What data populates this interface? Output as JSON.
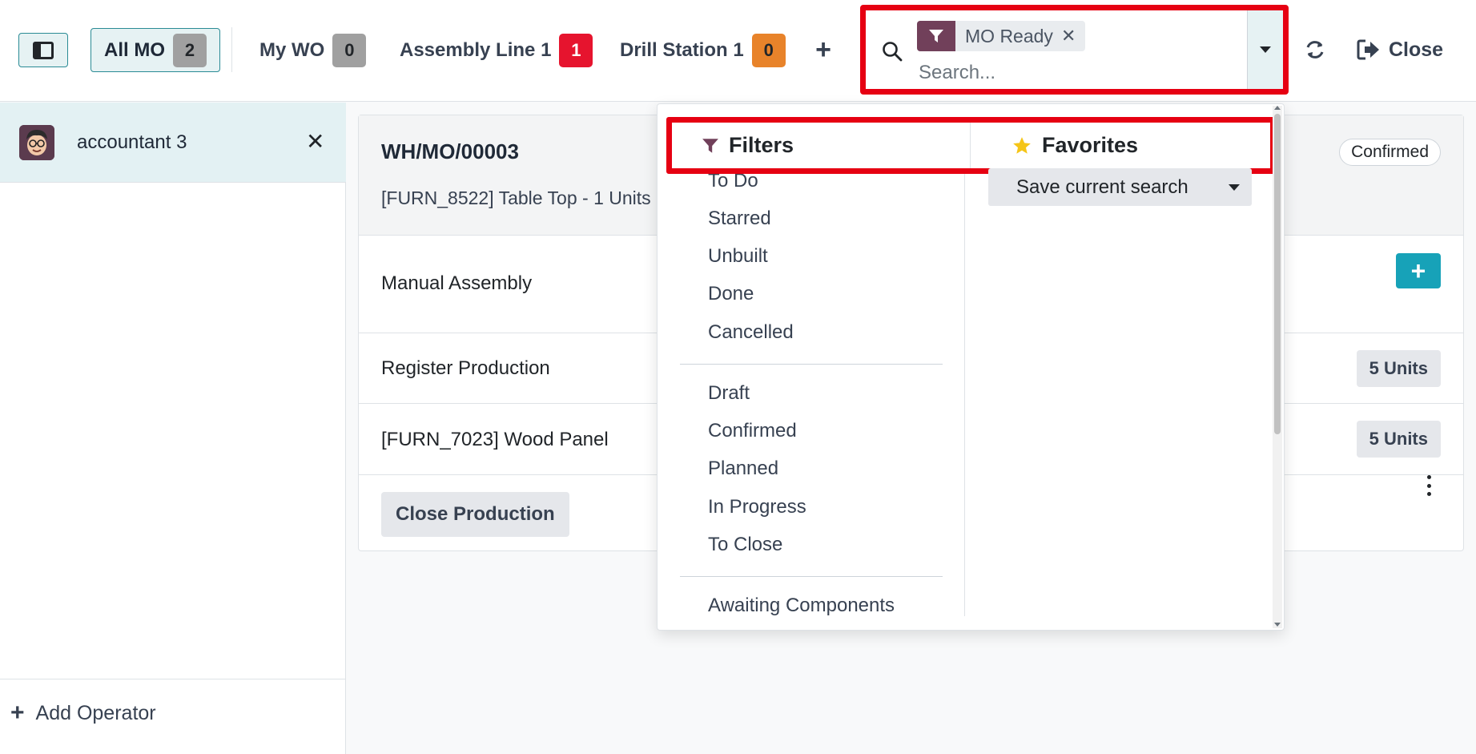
{
  "topbar": {
    "tabs": [
      {
        "label": "All MO",
        "count": "2",
        "active": true,
        "badge_color": "#a0a0a0"
      },
      {
        "label": "My WO",
        "count": "0",
        "active": false,
        "badge_color": "#a0a0a0"
      },
      {
        "label": "Assembly Line 1",
        "count": "1",
        "active": false,
        "badge_color": "#e6142e"
      },
      {
        "label": "Drill Station 1",
        "count": "0",
        "active": false,
        "badge_color": "#e8832a"
      }
    ],
    "add_tab_icon": "plus-icon",
    "close_label": "Close"
  },
  "search": {
    "facet_label": "MO Ready",
    "facet_icon": "filter-icon",
    "placeholder": "Search..."
  },
  "dropdown": {
    "filters_title": "Filters",
    "favorites_title": "Favorites",
    "filter_groups": [
      [
        "To Do",
        "Starred",
        "Unbuilt",
        "Done",
        "Cancelled"
      ],
      [
        "Draft",
        "Confirmed",
        "Planned",
        "In Progress",
        "To Close"
      ],
      [
        "Awaiting Components"
      ]
    ],
    "save_search_label": "Save current search"
  },
  "operator_panel": {
    "operator_name": "accountant 3",
    "add_operator_label": "Add Operator"
  },
  "mo_card": {
    "name": "WH/MO/00003",
    "product": "[FURN_8522] Table Top - 1 Units",
    "status": "Confirmed",
    "rows": [
      {
        "label": "Manual Assembly"
      },
      {
        "label": "Register Production",
        "units": "5 Units"
      },
      {
        "label": "[FURN_7023] Wood Panel",
        "units": "5 Units"
      }
    ],
    "close_production_label": "Close Production"
  },
  "colors": {
    "accent_teal": "#17a2b8",
    "facet_purple": "#71405a",
    "highlight_red": "#e60012",
    "star_yellow": "#f5c518"
  }
}
